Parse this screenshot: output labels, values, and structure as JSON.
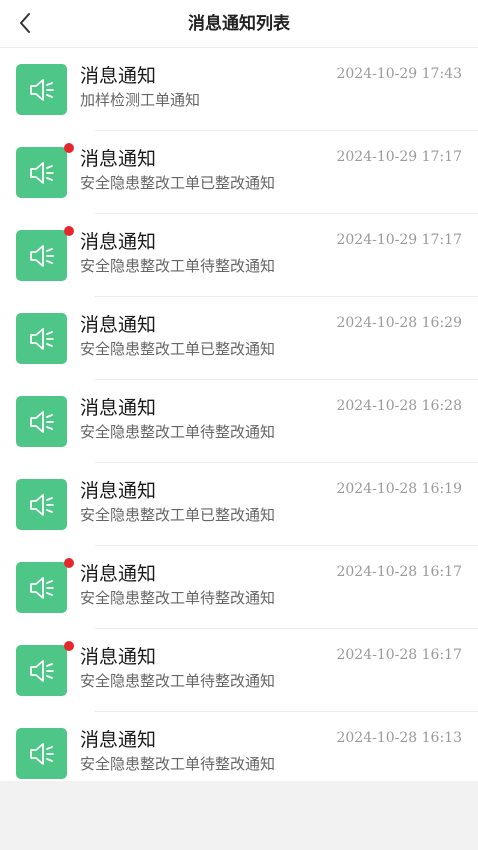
{
  "header": {
    "title": "消息通知列表",
    "back_icon": "chevron-left-icon"
  },
  "colors": {
    "icon_bg": "#4dc688",
    "unread_dot": "#e6282e"
  },
  "notifications": [
    {
      "title": "消息通知",
      "subtitle": "加样检测工单通知",
      "time": "2024-10-29 17:43",
      "unread": false,
      "icon": "speaker-icon"
    },
    {
      "title": "消息通知",
      "subtitle": "安全隐患整改工单已整改通知",
      "time": "2024-10-29 17:17",
      "unread": true,
      "icon": "speaker-icon"
    },
    {
      "title": "消息通知",
      "subtitle": "安全隐患整改工单待整改通知",
      "time": "2024-10-29 17:17",
      "unread": true,
      "icon": "speaker-icon"
    },
    {
      "title": "消息通知",
      "subtitle": "安全隐患整改工单已整改通知",
      "time": "2024-10-28 16:29",
      "unread": false,
      "icon": "speaker-icon"
    },
    {
      "title": "消息通知",
      "subtitle": "安全隐患整改工单待整改通知",
      "time": "2024-10-28 16:28",
      "unread": false,
      "icon": "speaker-icon"
    },
    {
      "title": "消息通知",
      "subtitle": "安全隐患整改工单已整改通知",
      "time": "2024-10-28 16:19",
      "unread": false,
      "icon": "speaker-icon"
    },
    {
      "title": "消息通知",
      "subtitle": "安全隐患整改工单待整改通知",
      "time": "2024-10-28 16:17",
      "unread": true,
      "icon": "speaker-icon"
    },
    {
      "title": "消息通知",
      "subtitle": "安全隐患整改工单待整改通知",
      "time": "2024-10-28 16:17",
      "unread": true,
      "icon": "speaker-icon"
    },
    {
      "title": "消息通知",
      "subtitle": "安全隐患整改工单待整改通知",
      "time": "2024-10-28 16:13",
      "unread": false,
      "icon": "speaker-icon"
    }
  ]
}
